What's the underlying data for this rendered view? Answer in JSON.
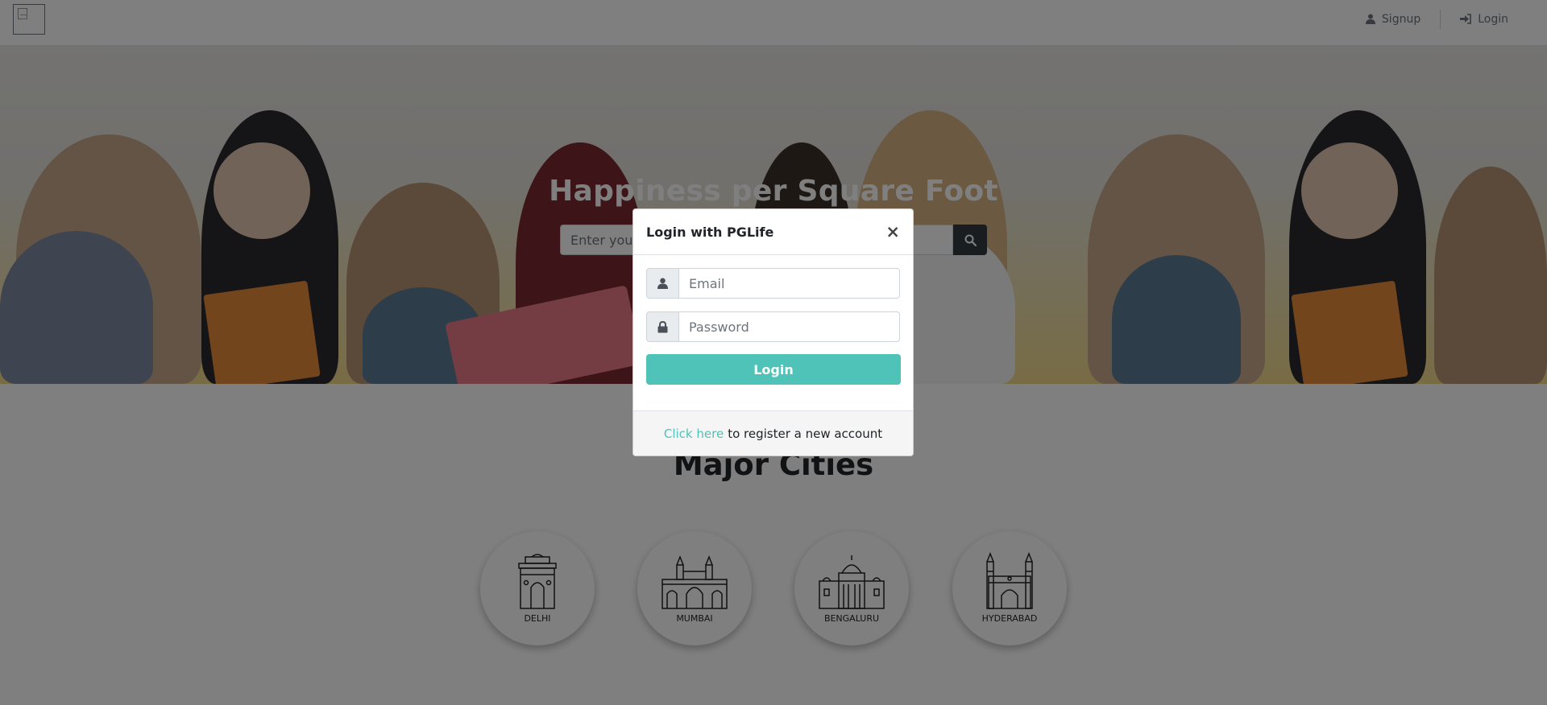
{
  "nav": {
    "signup_label": "Signup",
    "login_label": "Login"
  },
  "banner": {
    "title": "Happiness per Square Foot",
    "search_placeholder": "Enter your city to search for PGs"
  },
  "cities": {
    "title": "Major Cities",
    "items": [
      {
        "name": "DELHI",
        "icon": "india-gate-icon"
      },
      {
        "name": "MUMBAI",
        "icon": "gateway-of-india-icon"
      },
      {
        "name": "BENGALURU",
        "icon": "vidhana-soudha-icon"
      },
      {
        "name": "HYDERABAD",
        "icon": "charminar-icon"
      }
    ]
  },
  "modal": {
    "title": "Login with PGLife",
    "close_symbol": "×",
    "email_placeholder": "Email",
    "password_placeholder": "Password",
    "login_button": "Login",
    "footer_link": "Click here",
    "footer_text": "to register a new account"
  },
  "colors": {
    "accent": "#4fc3b7",
    "dark_button": "#343a40",
    "backdrop": "rgba(0,0,0,0.5)"
  }
}
